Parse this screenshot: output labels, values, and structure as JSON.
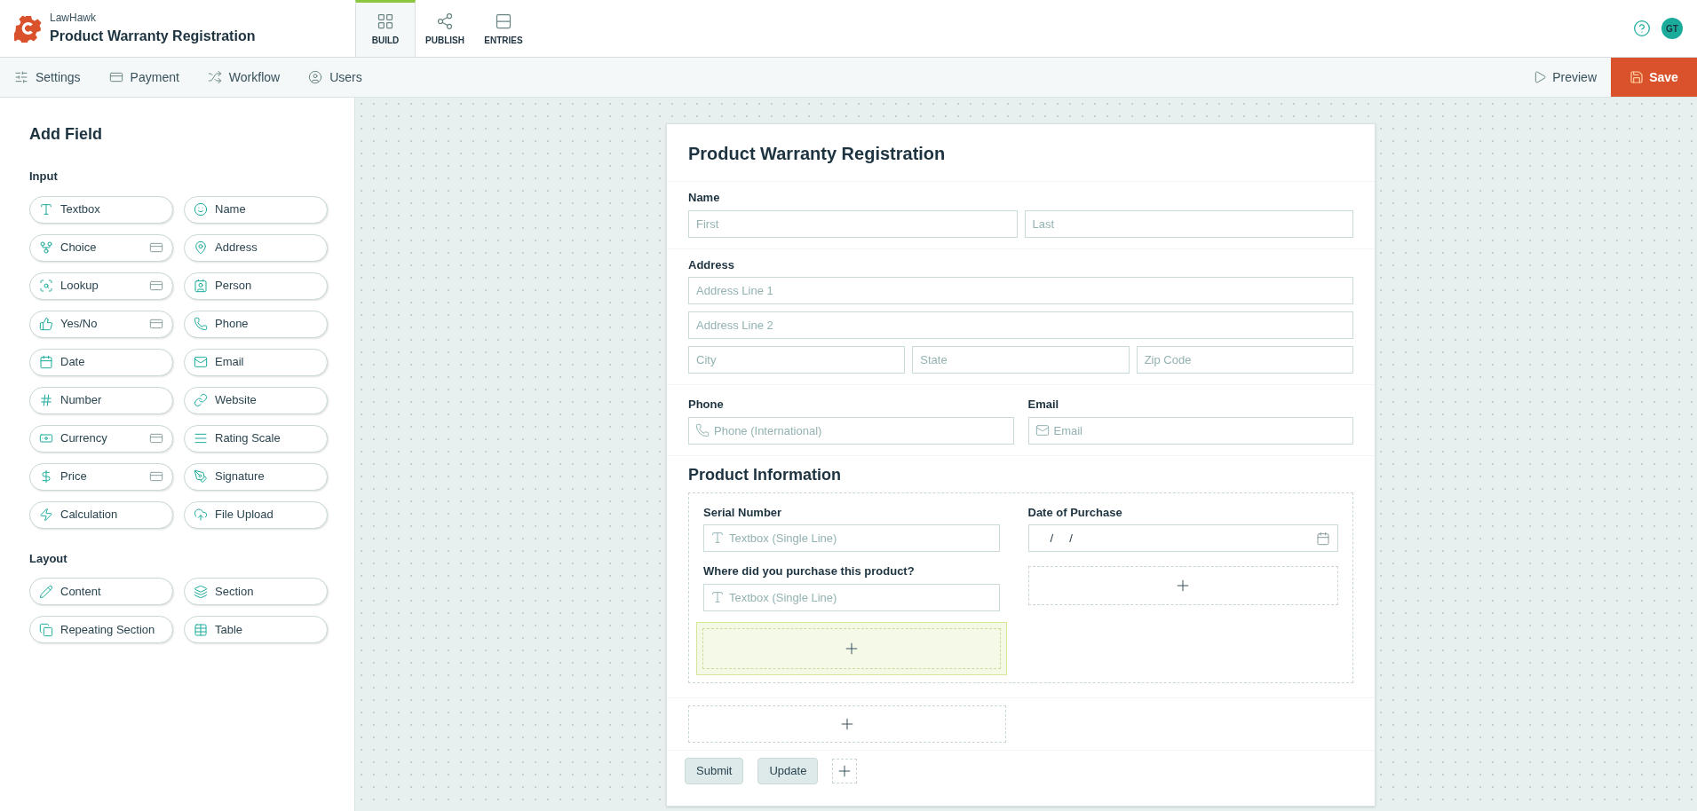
{
  "header": {
    "brand": "LawHawk",
    "title": "Product Warranty Registration",
    "tabs": [
      {
        "label": "BUILD",
        "selected": true
      },
      {
        "label": "PUBLISH",
        "selected": false
      },
      {
        "label": "ENTRIES",
        "selected": false
      }
    ],
    "avatar": "GT"
  },
  "subnav": {
    "items": [
      "Settings",
      "Payment",
      "Workflow",
      "Users"
    ],
    "preview": "Preview",
    "save": "Save"
  },
  "sidebar": {
    "title": "Add Field",
    "groups": [
      {
        "title": "Input",
        "items": [
          {
            "label": "Textbox",
            "premium": false
          },
          {
            "label": "Name",
            "premium": false
          },
          {
            "label": "Choice",
            "premium": true
          },
          {
            "label": "Address",
            "premium": false
          },
          {
            "label": "Lookup",
            "premium": true
          },
          {
            "label": "Person",
            "premium": false
          },
          {
            "label": "Yes/No",
            "premium": true
          },
          {
            "label": "Phone",
            "premium": false
          },
          {
            "label": "Date",
            "premium": false
          },
          {
            "label": "Email",
            "premium": false
          },
          {
            "label": "Number",
            "premium": false
          },
          {
            "label": "Website",
            "premium": false
          },
          {
            "label": "Currency",
            "premium": true
          },
          {
            "label": "Rating Scale",
            "premium": false
          },
          {
            "label": "Price",
            "premium": true
          },
          {
            "label": "Signature",
            "premium": false
          },
          {
            "label": "Calculation",
            "premium": false
          },
          {
            "label": "File Upload",
            "premium": false
          }
        ]
      },
      {
        "title": "Layout",
        "items": [
          {
            "label": "Content",
            "premium": false
          },
          {
            "label": "Section",
            "premium": false
          },
          {
            "label": "Repeating Section",
            "premium": false
          },
          {
            "label": "Table",
            "premium": false
          }
        ]
      }
    ]
  },
  "form": {
    "title": "Product Warranty Registration",
    "name": {
      "label": "Name",
      "fields": [
        {
          "placeholder": "First"
        },
        {
          "placeholder": "Last"
        }
      ]
    },
    "address": {
      "label": "Address",
      "lines": [
        {
          "placeholder": "Address Line 1"
        },
        {
          "placeholder": "Address Line 2"
        }
      ],
      "row": [
        {
          "placeholder": "City"
        },
        {
          "placeholder": "State"
        },
        {
          "placeholder": "Zip Code"
        }
      ]
    },
    "contact": [
      {
        "label": "Phone",
        "placeholder": "Phone (International)",
        "kind": "phone"
      },
      {
        "label": "Email",
        "placeholder": "Email",
        "kind": "email"
      }
    ],
    "section": {
      "title": "Product Information",
      "left": [
        {
          "label": "Serial Number",
          "placeholder": "Textbox (Single Line)"
        },
        {
          "label": "Where did you purchase this product?",
          "placeholder": "Textbox (Single Line)"
        }
      ],
      "date": {
        "label": "Date of Purchase",
        "value": "/     /"
      },
      "left_dropzone": {
        "highlighted": true
      },
      "right_dropzone": {
        "highlighted": false
      }
    },
    "buttons": [
      "Submit",
      "Update"
    ]
  }
}
